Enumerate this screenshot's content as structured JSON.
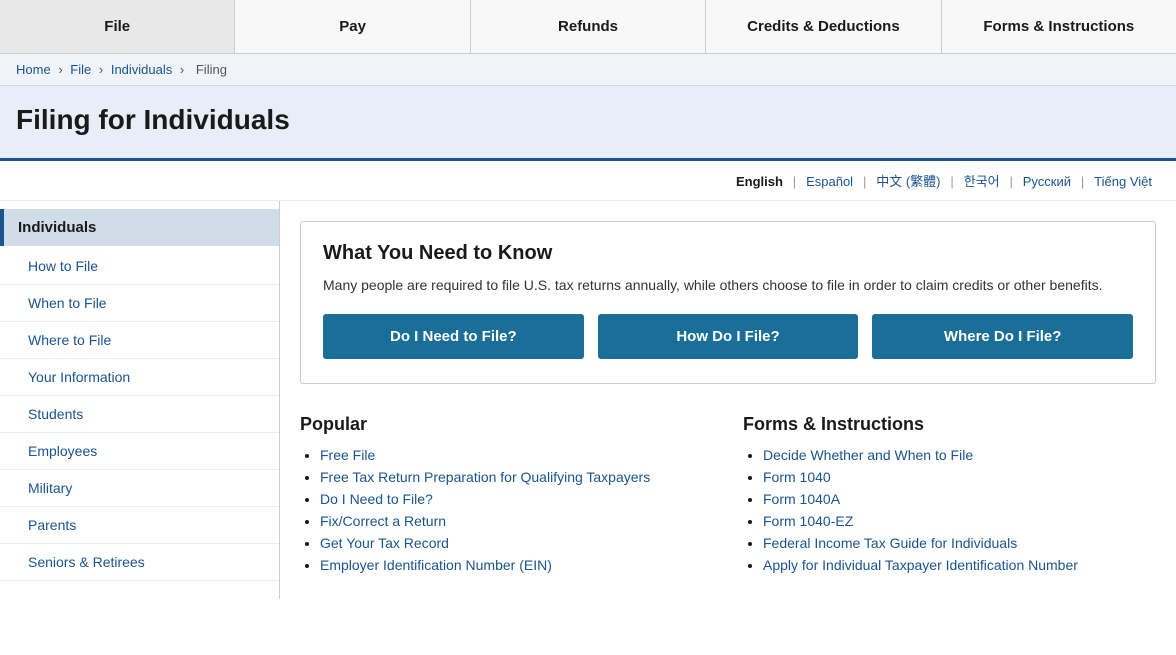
{
  "nav": {
    "items": [
      {
        "label": "File",
        "id": "nav-file"
      },
      {
        "label": "Pay",
        "id": "nav-pay"
      },
      {
        "label": "Refunds",
        "id": "nav-refunds"
      },
      {
        "label": "Credits & Deductions",
        "id": "nav-credits"
      },
      {
        "label": "Forms & Instructions",
        "id": "nav-forms"
      }
    ]
  },
  "breadcrumb": {
    "items": [
      "Home",
      "File",
      "Individuals",
      "Filing"
    ]
  },
  "page_title": "Filing for Individuals",
  "languages": [
    {
      "label": "English",
      "active": true
    },
    {
      "label": "Español"
    },
    {
      "label": "中文 (繁體)"
    },
    {
      "label": "한국어"
    },
    {
      "label": "Русский"
    },
    {
      "label": "Tiếng Việt"
    }
  ],
  "sidebar": {
    "section_title": "Individuals",
    "items": [
      "How to File",
      "When to File",
      "Where to File",
      "Your Information",
      "Students",
      "Employees",
      "Military",
      "Parents",
      "Seniors & Retirees"
    ]
  },
  "infobox": {
    "title": "What You Need to Know",
    "description": "Many people are required to file U.S. tax returns annually, while others choose to file in order to claim credits or other benefits.",
    "buttons": [
      "Do I Need to File?",
      "How Do I File?",
      "Where Do I File?"
    ]
  },
  "popular": {
    "section_title": "Popular",
    "items": [
      {
        "label": "Free File"
      },
      {
        "label": "Free Tax Return Preparation for Qualifying Taxpayers"
      },
      {
        "label": "Do I Need to File?"
      },
      {
        "label": "Fix/Correct a Return"
      },
      {
        "label": "Get Your Tax Record"
      },
      {
        "label": "Employer Identification Number (EIN)"
      }
    ]
  },
  "forms_instructions": {
    "section_title": "Forms & Instructions",
    "items": [
      {
        "label": "Decide Whether and When to File"
      },
      {
        "label": "Form 1040"
      },
      {
        "label": "Form 1040A"
      },
      {
        "label": "Form 1040-EZ"
      },
      {
        "label": "Federal Income Tax Guide for Individuals"
      },
      {
        "label": "Apply for Individual Taxpayer Identification Number"
      }
    ]
  }
}
